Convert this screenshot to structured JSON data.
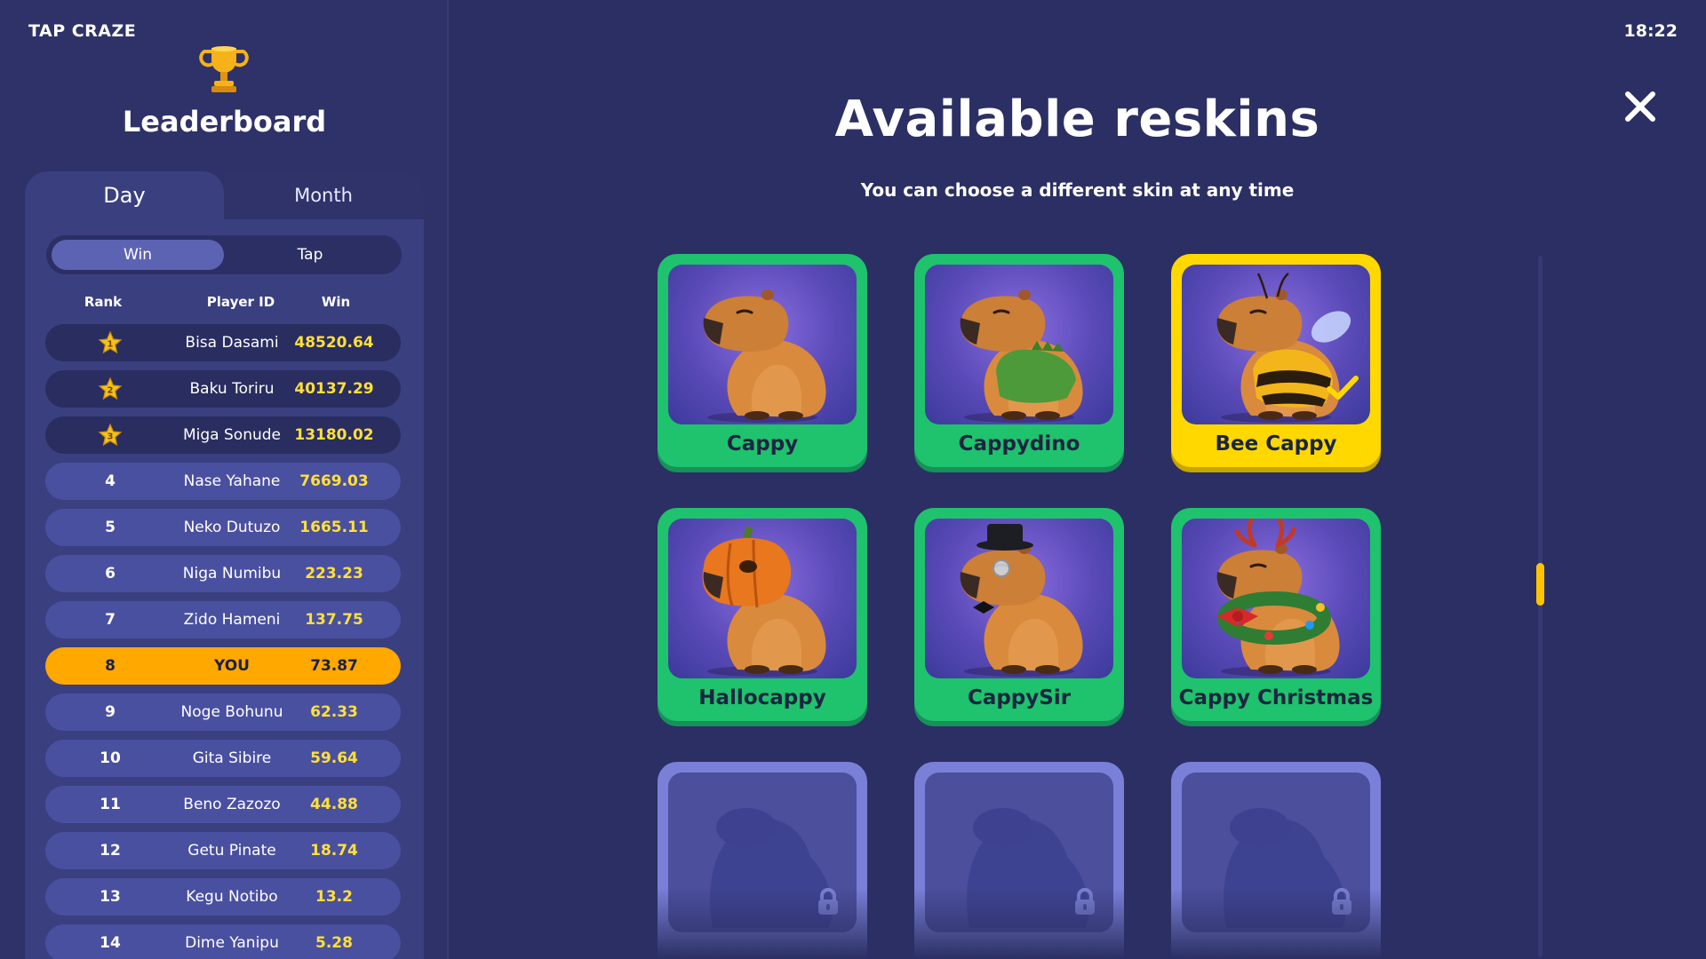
{
  "app": {
    "title": "TAP CRAZE",
    "clock": "18:22"
  },
  "leaderboard": {
    "title": "Leaderboard",
    "tabs": [
      {
        "label": "Day",
        "active": true
      },
      {
        "label": "Month",
        "active": false
      }
    ],
    "modes": [
      {
        "label": "Win",
        "active": true
      },
      {
        "label": "Tap",
        "active": false
      }
    ],
    "columns": {
      "rank": "Rank",
      "player": "Player ID",
      "win": "Win"
    },
    "rows": [
      {
        "rank": "1",
        "name": "Bisa Dasami",
        "win": "48520.64",
        "badge": "gold-star-1"
      },
      {
        "rank": "2",
        "name": "Baku Toriru",
        "win": "40137.29",
        "badge": "gold-star-2"
      },
      {
        "rank": "3",
        "name": "Miga Sonude",
        "win": "13180.02",
        "badge": "gold-star-3"
      },
      {
        "rank": "4",
        "name": "Nase Yahane",
        "win": "7669.03"
      },
      {
        "rank": "5",
        "name": "Neko Dutuzo",
        "win": "1665.11"
      },
      {
        "rank": "6",
        "name": "Niga Numibu",
        "win": "223.23"
      },
      {
        "rank": "7",
        "name": "Zido Hameni",
        "win": "137.75"
      },
      {
        "rank": "8",
        "name": "YOU",
        "win": "73.87",
        "is_me": true
      },
      {
        "rank": "9",
        "name": "Noge Bohunu",
        "win": "62.33"
      },
      {
        "rank": "10",
        "name": "Gita Sibire",
        "win": "59.64"
      },
      {
        "rank": "11",
        "name": "Beno Zazozo",
        "win": "44.88"
      },
      {
        "rank": "12",
        "name": "Getu Pinate",
        "win": "18.74"
      },
      {
        "rank": "13",
        "name": "Kegu Notibo",
        "win": "13.2"
      },
      {
        "rank": "14",
        "name": "Dime Yanipu",
        "win": "5.28"
      }
    ]
  },
  "reskins": {
    "title": "Available reskins",
    "subtitle": "You can choose a different skin at any time",
    "items": [
      {
        "name": "Cappy",
        "state": "available",
        "accessory": "none"
      },
      {
        "name": "Cappydino",
        "state": "available",
        "accessory": "dino-sweater"
      },
      {
        "name": "Bee Cappy",
        "state": "selected",
        "accessory": "bee-costume"
      },
      {
        "name": "Hallocappy",
        "state": "available",
        "accessory": "pumpkin-mask"
      },
      {
        "name": "CappySir",
        "state": "available",
        "accessory": "top-hat-monocle"
      },
      {
        "name": "Cappy Christmas",
        "state": "available",
        "accessory": "antlers-wreath"
      },
      {
        "name": "",
        "state": "locked"
      },
      {
        "name": "",
        "state": "locked"
      },
      {
        "name": "",
        "state": "locked"
      }
    ]
  },
  "icons": {
    "trophy": "trophy-icon",
    "close": "close-icon",
    "lock": "lock-icon",
    "check": "checkmark-icon"
  },
  "colors": {
    "background": "#2b2f63",
    "accent_yellow": "#ffd800",
    "accent_green": "#1fc26d",
    "highlight_orange": "#ffa800",
    "win_text": "#ffe03a"
  }
}
